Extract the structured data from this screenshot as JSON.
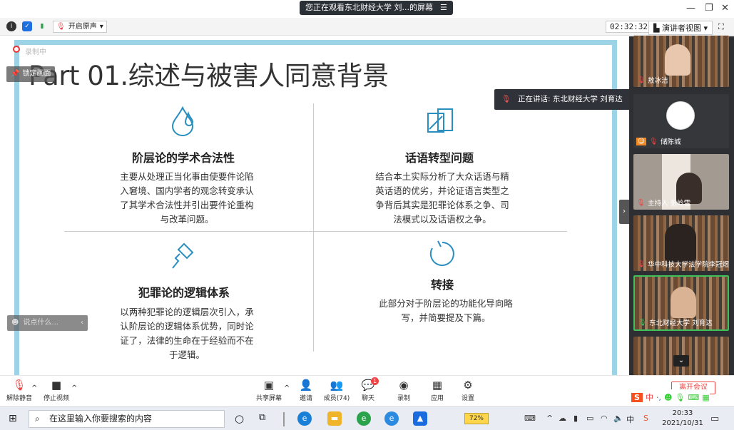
{
  "window": {
    "share_banner": "您正在观看东北财经大学 刘...的屏幕",
    "share_banner_menu": "☰",
    "min": "—",
    "restore": "❐",
    "close": "✕"
  },
  "toolbar": {
    "original_sound": "开启原声",
    "timer": "02:32:32",
    "view_mode": "演讲者视图",
    "view_caret": "▾"
  },
  "slide": {
    "recording_label": "录制中",
    "lock_label": "锁定画面",
    "title": "Part 01.综述与被害人同意背景",
    "q1": {
      "title": "阶层论的学术合法性",
      "lines": [
        "主要从处理正当化事由使要件论陷",
        "入窘境、国内学者的观念转变承认",
        "了其学术合法性并引出要件论重构",
        "与改革问题。"
      ]
    },
    "q2": {
      "title": "话语转型问题",
      "lines": [
        "结合本土实际分析了大众话语与精",
        "英话语的优劣，并论证语言类型之",
        "争背后其实是犯罪论体系之争、司",
        "法模式以及话语权之争。"
      ]
    },
    "q3": {
      "title": "犯罪论的逻辑体系",
      "lines": [
        "以两种犯罪论的逻辑层次引入，承",
        "认阶层论的逻辑体系优势，同时论",
        "证了，法律的生命在于经验而不在",
        "于逻辑。"
      ]
    },
    "q4": {
      "title": "转接",
      "lines": [
        "此部分对于阶层论的功能化导向略",
        "写，并简要提及下篇。"
      ]
    },
    "chat_placeholder": "说点什么..."
  },
  "speaker_tip": "正在讲话: 东北财经大学 刘育达",
  "participants": [
    {
      "name": "敖冰洁"
    },
    {
      "name": "储陈城"
    },
    {
      "name": "主持人 张岭雪"
    },
    {
      "name": "华中科技大学法学院李冠煜"
    },
    {
      "name": "东北财经大学 刘育达"
    }
  ],
  "meeting_bar": {
    "unmute": "解除静音",
    "stop_video": "停止视频",
    "share": "共享屏幕",
    "invite": "邀请",
    "members": "成员(74)",
    "chat": "聊天",
    "chat_badge": "1",
    "record": "录制",
    "apps": "应用",
    "settings": "设置",
    "end": "离开会议"
  },
  "taskbar": {
    "search_placeholder": "在这里输入你要搜索的内容",
    "battery": "72%",
    "time": "20:33",
    "date": "2021/10/31"
  }
}
